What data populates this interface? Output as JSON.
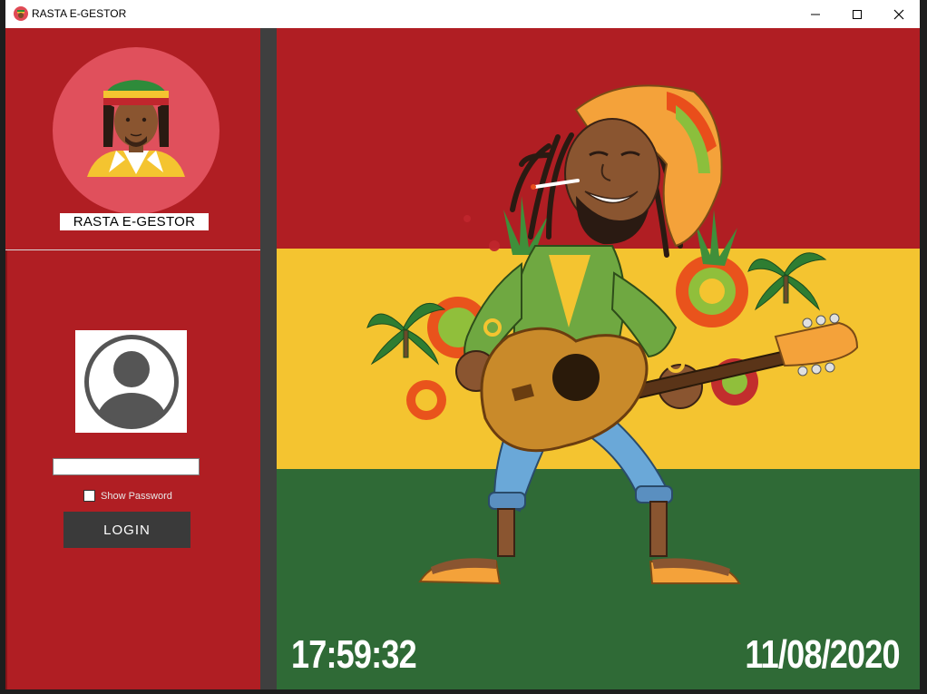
{
  "window": {
    "title": "RASTA E-GESTOR",
    "icon": "rasta-app-icon",
    "controls": [
      "minimize-icon",
      "maximize-icon",
      "close-icon"
    ]
  },
  "sidebar": {
    "logo_caption": "RASTA E-GESTOR",
    "password_value": "",
    "show_password_label": "Show Password",
    "show_password_checked": false,
    "login_label": "LOGIN"
  },
  "main": {
    "flag_colors": [
      "#b01e23",
      "#f4c430",
      "#2f6a36"
    ],
    "clock": "17:59:32",
    "date": "11/08/2020"
  },
  "colors": {
    "sidebar": "#b01e23",
    "separator": "#3f3f3f",
    "login_button": "#3a3a3a"
  }
}
